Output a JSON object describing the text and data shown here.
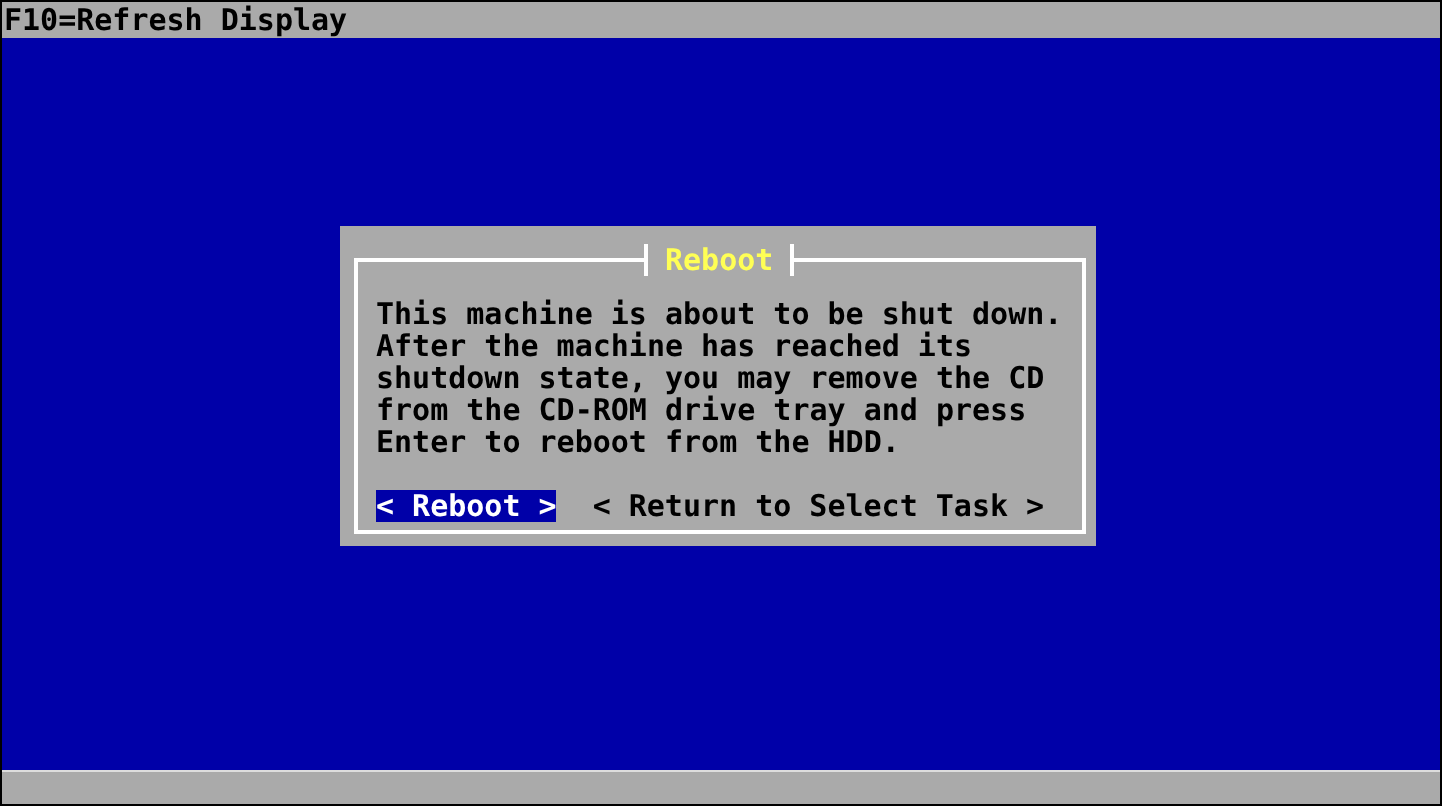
{
  "top_bar": {
    "text": "F10=Refresh Display"
  },
  "dialog": {
    "title": "Reboot",
    "message": [
      "This machine is about to be shut down.",
      "After the machine has reached its",
      "shutdown state, you may remove the CD",
      "from the CD-ROM drive tray and press",
      "Enter to reboot from the HDD."
    ],
    "buttons": [
      {
        "label": "< Reboot >",
        "selected": true
      },
      {
        "label": "< Return to Select Task >",
        "selected": false
      }
    ]
  }
}
